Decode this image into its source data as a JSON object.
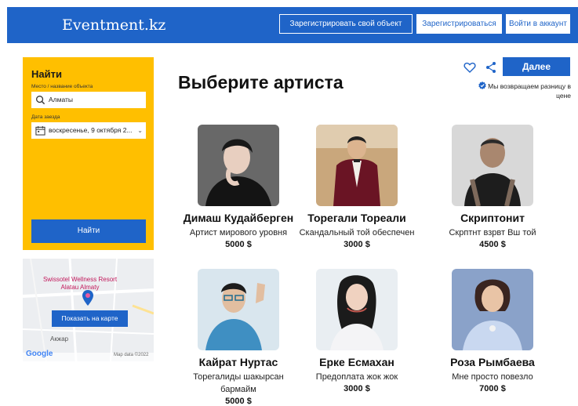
{
  "header": {
    "brand": "Eventment.kz",
    "register_object": "Зарегистрировать свой объект",
    "register": "Зарегистрироваться",
    "login": "Войти в аккаунт"
  },
  "search": {
    "title": "Найти",
    "place_label": "Место / название объекта",
    "place_value": "Алматы",
    "date_label": "Дата заезда",
    "date_value": "воскресенье, 9 октября 2...",
    "button": "Найти"
  },
  "map": {
    "place_name": "Swissotel Wellness Resort Alatau Almaty",
    "button": "Показать на карте",
    "road_label": "Акжар",
    "google": "Google",
    "credit": "Map data ©2022"
  },
  "main": {
    "title": "Выберите артиста",
    "next_button": "Далее",
    "guarantee": "Мы возвращаем разницу в цене"
  },
  "artists": [
    {
      "name": "Димаш Кудайберген",
      "desc": "Артист мирового уровня",
      "price": "5000 $",
      "bg": "#8c8c8c"
    },
    {
      "name": "Торегали Тореали",
      "desc": "Скандальный той обеспечен",
      "price": "3000 $",
      "bg": "#c9a77c"
    },
    {
      "name": "Скриптонит",
      "desc": "Скрптнт взрвт Вш той",
      "price": "4500 $",
      "bg": "#d8d8d8"
    },
    {
      "name": "Кайрат Нуртас",
      "desc": "Торегалиды шакырсан бармайм",
      "price": "5000 $",
      "bg": "#d9e6ee"
    },
    {
      "name": "Ерке Есмахан",
      "desc": "Предоплата жок жок",
      "price": "3000 $",
      "bg": "#e9eef2"
    },
    {
      "name": "Роза Рымбаева",
      "desc": "Мне просто повезло",
      "price": "7000 $",
      "bg": "#8aa2c9"
    }
  ],
  "colors": {
    "primary": "#1f64c8",
    "search_panel": "#ffbf00"
  }
}
